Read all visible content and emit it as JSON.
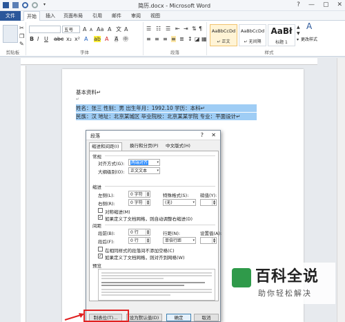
{
  "window": {
    "title": "简历.docx - Microsoft Word",
    "help": "?",
    "minimize": "—",
    "restore": "▢",
    "close": "✕"
  },
  "ribbon_tabs": [
    "文件",
    "开始",
    "插入",
    "页面布局",
    "引用",
    "邮件",
    "审阅",
    "视图"
  ],
  "ribbon": {
    "font_size": "五号",
    "groups": [
      "剪贴板",
      "字体",
      "段落",
      "样式"
    ],
    "styles": [
      {
        "preview": "AaBbCcDd",
        "name": "↵ 正文",
        "selected": true
      },
      {
        "preview": "AaBbCcDd",
        "name": "↵ 无间隔",
        "selected": false
      },
      {
        "preview": "AaBł",
        "name": "标题 1",
        "selected": false
      }
    ],
    "change_styles": "更改样式"
  },
  "document": {
    "heading": "基本资料↵",
    "blank": "↵",
    "line1": "姓名：张三    性别：男              出生年月：1992.10        学历：本科↵",
    "line2": "民族：汉     地址：北京某城区     毕业院校：北京某某学院     专业：平面设计↵"
  },
  "dialog": {
    "title": "段落",
    "help": "?",
    "close": "✕",
    "tabs": [
      "缩进和间距(I)",
      "换行和分页(P)",
      "中文版式(H)"
    ],
    "general": {
      "section": "常规",
      "alignment_label": "对齐方式(G):",
      "alignment_value": "两端对齐",
      "outline_label": "大纲级别(O):",
      "outline_value": "正文文本"
    },
    "indent": {
      "section": "缩进",
      "left_label": "左侧(L):",
      "left_value": "0 字符",
      "right_label": "右侧(R):",
      "right_value": "0 字符",
      "special_label": "特殊格式(S):",
      "special_value": "(无)",
      "by_label": "磅值(Y):",
      "mirror_label": "对称缩进(M)",
      "auto_adjust_label": "如果定义了文档网格，则自动调整右缩进(D)"
    },
    "spacing": {
      "section": "间距",
      "before_label": "段前(B):",
      "before_value": "0 行",
      "after_label": "段后(F):",
      "after_value": "0 行",
      "line_label": "行距(N):",
      "line_value": "单倍行距",
      "at_label": "设置值(A):",
      "no_space_label": "在相同样式的段落间不添加空格(C)",
      "snap_grid_label": "如果定义了文档网格，则对齐到网格(W)"
    },
    "preview_label": "预览",
    "buttons": {
      "tabs": "制表位(T)...",
      "default": "设为默认值(D)",
      "ok": "确定",
      "cancel": "取消"
    }
  },
  "watermark": {
    "title": "百科全说",
    "subtitle": "助你轻松解决"
  },
  "colors": {
    "accent": "#2b579a",
    "highlight": "#9fcdf5",
    "callout": "#e02020",
    "logo": "#2f9a4a"
  }
}
